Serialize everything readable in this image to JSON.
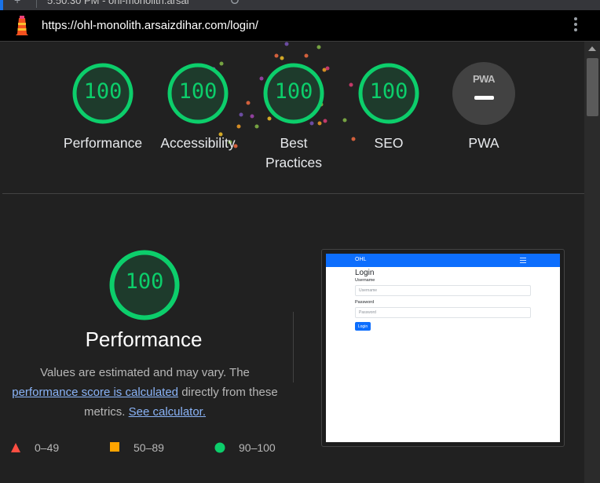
{
  "browser": {
    "tab_title": "5:50:30 PM - ohl-monolith.arsai",
    "url": "https://ohl-monolith.arsaizdihar.com/login/"
  },
  "colors": {
    "pass": "#0cce6b",
    "average": "#ffa400",
    "fail": "#ff4e42",
    "link": "#8ab4f8",
    "background": "#212121"
  },
  "summary": {
    "categories": [
      {
        "label": "Performance",
        "score": "100"
      },
      {
        "label": "Accessibility",
        "score": "100"
      },
      {
        "label": "Best Practices",
        "score": "100"
      },
      {
        "label": "SEO",
        "score": "100"
      }
    ],
    "pwa": {
      "badge": "PWA",
      "label": "PWA"
    }
  },
  "performance": {
    "score": "100",
    "title": "Performance",
    "desc_prefix": "Values are estimated and may vary. The",
    "desc_link": "performance score is calculated",
    "desc_middle": "directly from these metrics.",
    "desc_link2": "See calculator.",
    "legend": [
      {
        "range": "0–49",
        "icon": "red-triangle-icon"
      },
      {
        "range": "50–89",
        "icon": "orange-square-icon"
      },
      {
        "range": "90–100",
        "icon": "green-circle-icon"
      }
    ]
  },
  "screenshot": {
    "brand": "OHL",
    "title": "Login",
    "username_label": "Username",
    "username_placeholder": "Username",
    "password_label": "Password",
    "password_placeholder": "Password",
    "button": "Login"
  }
}
